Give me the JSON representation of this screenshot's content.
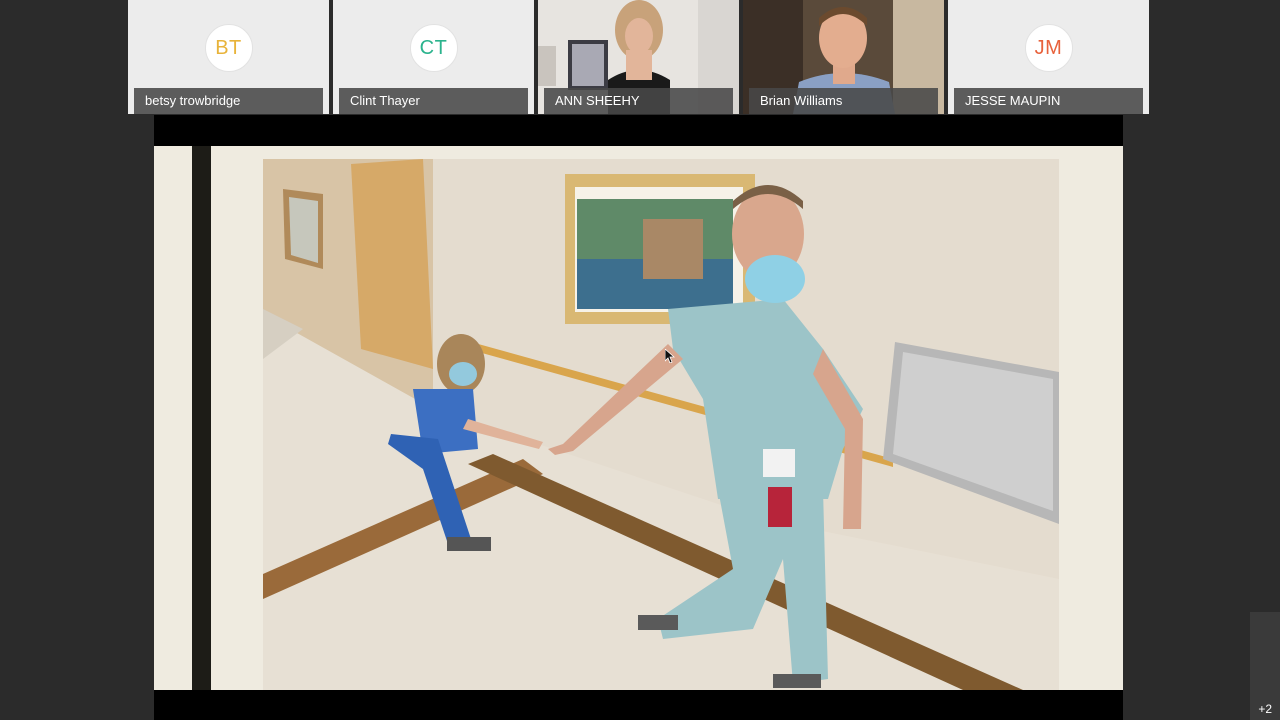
{
  "participants": [
    {
      "type": "avatar",
      "initials": "BT",
      "name": "betsy trowbridge",
      "color": "#e8b33a"
    },
    {
      "type": "avatar",
      "initials": "CT",
      "name": "Clint Thayer",
      "color": "#2bb38d"
    },
    {
      "type": "video",
      "name": "ANN SHEEHY"
    },
    {
      "type": "video",
      "name": "Brian Williams"
    },
    {
      "type": "avatar",
      "initials": "JM",
      "name": "JESSE MAUPIN",
      "color": "#e8623c"
    }
  ],
  "overflow": {
    "label": "+2"
  },
  "colors": {
    "background": "#2b2b2b",
    "tile": "#ececec",
    "slide": "#efebe0"
  }
}
